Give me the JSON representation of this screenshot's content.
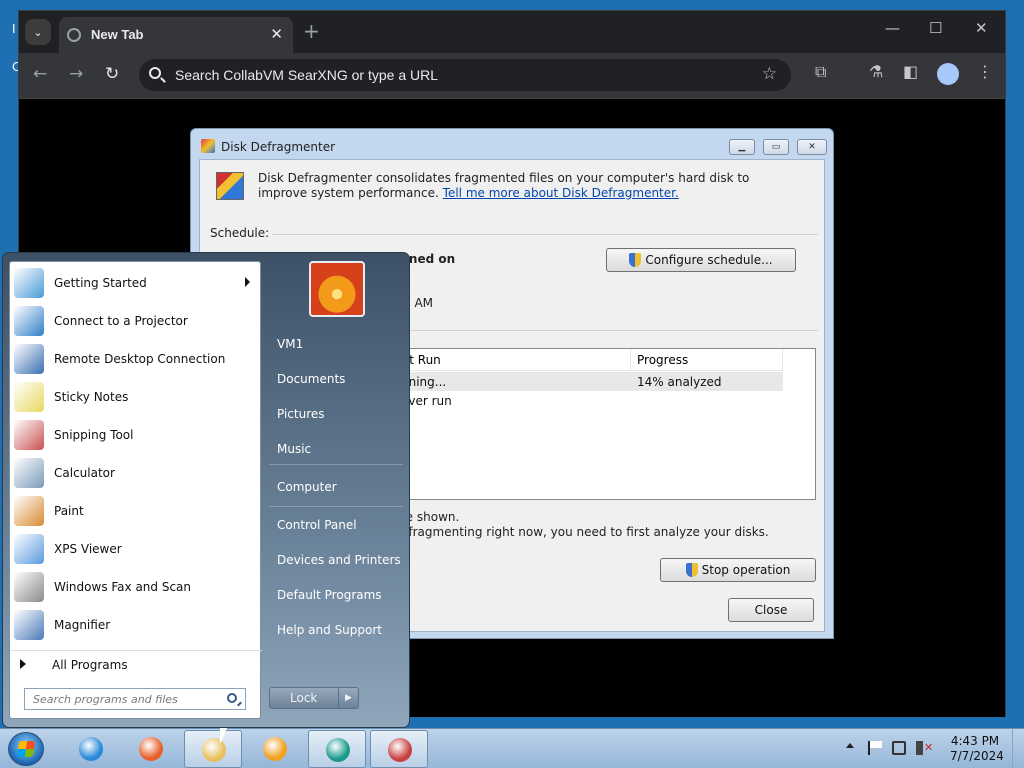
{
  "desktop": {
    "letters": [
      "I",
      "C"
    ]
  },
  "browser": {
    "tab_title": "New Tab",
    "tab_close": "✕",
    "new_tab": "+",
    "minimize": "—",
    "maximize": "☐",
    "close": "✕",
    "back": "←",
    "forward": "→",
    "reload": "↻",
    "address_placeholder": "Search CollabVM SearXNG or type a URL",
    "star": "☆",
    "extensions": "⧉",
    "labs": "⚗",
    "sidepanel": "◧",
    "menu": "⋮",
    "tab_menu": "⌄"
  },
  "defrag": {
    "title": "Disk Defragmenter",
    "description": "Disk Defragmenter consolidates fragmented files on your computer's hard disk to improve system performance.",
    "link": "Tell me more about Disk Defragmenter.",
    "schedule_label": "Schedule:",
    "schedule_status_partial": "rned on",
    "schedule_time_partial": "0 AM",
    "configure_button": "Configure schedule...",
    "columns": {
      "last_run_partial": "st Run",
      "progress": "Progress"
    },
    "rows": [
      {
        "last_run": "nning...",
        "progress": "14% analyzed"
      },
      {
        "last_run": "ever run",
        "progress": ""
      }
    ],
    "note1_partial": "re shown.",
    "note2_partial": "efragmenting right now, you need to first analyze your disks.",
    "stop_button": "Stop operation",
    "close_button": "Close",
    "cap_min": "▁",
    "cap_max": "▭",
    "cap_close": "✕"
  },
  "start_menu": {
    "programs": [
      {
        "label": "Getting Started",
        "icon": "getting-started-icon",
        "color": "#4a9ad8",
        "submenu": true
      },
      {
        "label": "Connect to a Projector",
        "icon": "projector-icon",
        "color": "#2f7fc8",
        "submenu": false
      },
      {
        "label": "Remote Desktop Connection",
        "icon": "remote-desktop-icon",
        "color": "#3b6fb0",
        "submenu": false
      },
      {
        "label": "Sticky Notes",
        "icon": "sticky-notes-icon",
        "color": "#e8d860",
        "submenu": false
      },
      {
        "label": "Snipping Tool",
        "icon": "snipping-tool-icon",
        "color": "#c85050",
        "submenu": false
      },
      {
        "label": "Calculator",
        "icon": "calculator-icon",
        "color": "#7a9ab8",
        "submenu": false
      },
      {
        "label": "Paint",
        "icon": "paint-icon",
        "color": "#d88a30",
        "submenu": false
      },
      {
        "label": "XPS Viewer",
        "icon": "xps-viewer-icon",
        "color": "#5a9ae0",
        "submenu": false
      },
      {
        "label": "Windows Fax and Scan",
        "icon": "fax-scan-icon",
        "color": "#8a8a8a",
        "submenu": false
      },
      {
        "label": "Magnifier",
        "icon": "magnifier-icon",
        "color": "#4a7ab8",
        "submenu": false
      }
    ],
    "all_programs": "All Programs",
    "search_placeholder": "Search programs and files",
    "right_items": [
      "VM1",
      "Documents",
      "Pictures",
      "Music",
      "Computer",
      "Control Panel",
      "Devices and Printers",
      "Default Programs",
      "Help and Support"
    ],
    "lock_label": "Lock",
    "lock_arrow": "▶"
  },
  "taskbar": {
    "apps": [
      {
        "name": "internet-explorer-icon",
        "color": "#2a8ad8",
        "active": false
      },
      {
        "name": "firefox-icon",
        "color": "#e8602a",
        "active": false
      },
      {
        "name": "explorer-folder-icon",
        "color": "#e8c060",
        "active": true
      },
      {
        "name": "media-player-icon",
        "color": "#f0a020",
        "active": false
      },
      {
        "name": "chrome-app-icon",
        "color": "#1a9a8a",
        "active": true
      },
      {
        "name": "defrag-app-icon",
        "color": "#c84040",
        "active": true
      }
    ],
    "time": "4:43 PM",
    "date": "7/7/2024"
  }
}
